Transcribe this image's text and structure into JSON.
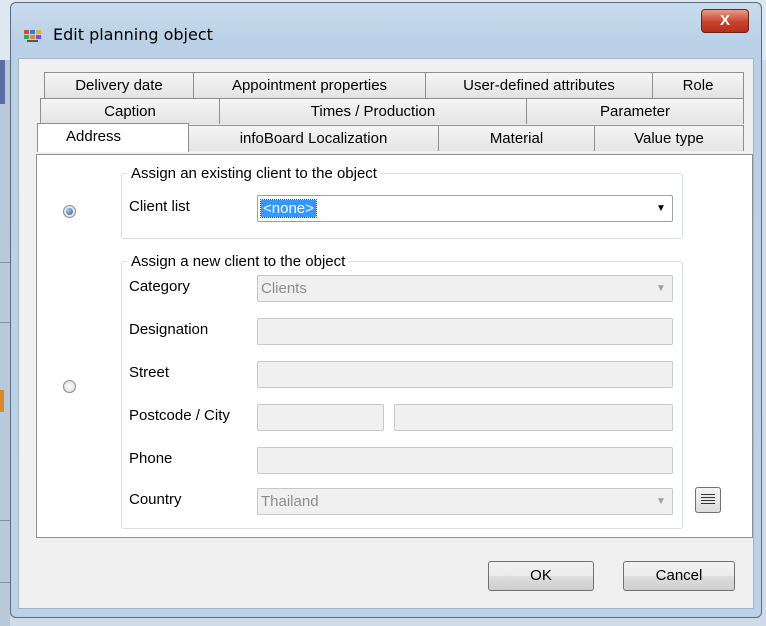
{
  "title": "Edit planning object",
  "close_glyph": "X",
  "tabs_row1": [
    "Delivery date",
    "Appointment properties",
    "User-defined attributes",
    "Role"
  ],
  "tabs_row2": [
    "Caption",
    "Times / Production",
    "Parameter"
  ],
  "tabs_row3": [
    "Address",
    "infoBoard Localization",
    "Material",
    "Value type"
  ],
  "existing_client": {
    "legend": "Assign an existing client to the object",
    "client_list_label": "Client list",
    "client_list_value": "<none>",
    "selected": true
  },
  "new_client": {
    "legend": "Assign a new client to the object",
    "selected": false,
    "category_label": "Category",
    "category_value": "Clients",
    "designation_label": "Designation",
    "designation_value": "",
    "street_label": "Street",
    "street_value": "",
    "postcode_city_label": "Postcode / City",
    "postcode_value": "",
    "city_value": "",
    "phone_label": "Phone",
    "phone_value": "",
    "country_label": "Country",
    "country_value": "Thailand"
  },
  "buttons": {
    "ok": "OK",
    "cancel": "Cancel"
  },
  "icons": {
    "app": "planning-app-icon",
    "close": "close-icon",
    "dropdown": "chevron-down-icon",
    "list": "list-icon"
  },
  "colors": {
    "selection": "#3399ff",
    "close_button": "#c7422c",
    "dialog_frame": "#b9d0e6"
  }
}
